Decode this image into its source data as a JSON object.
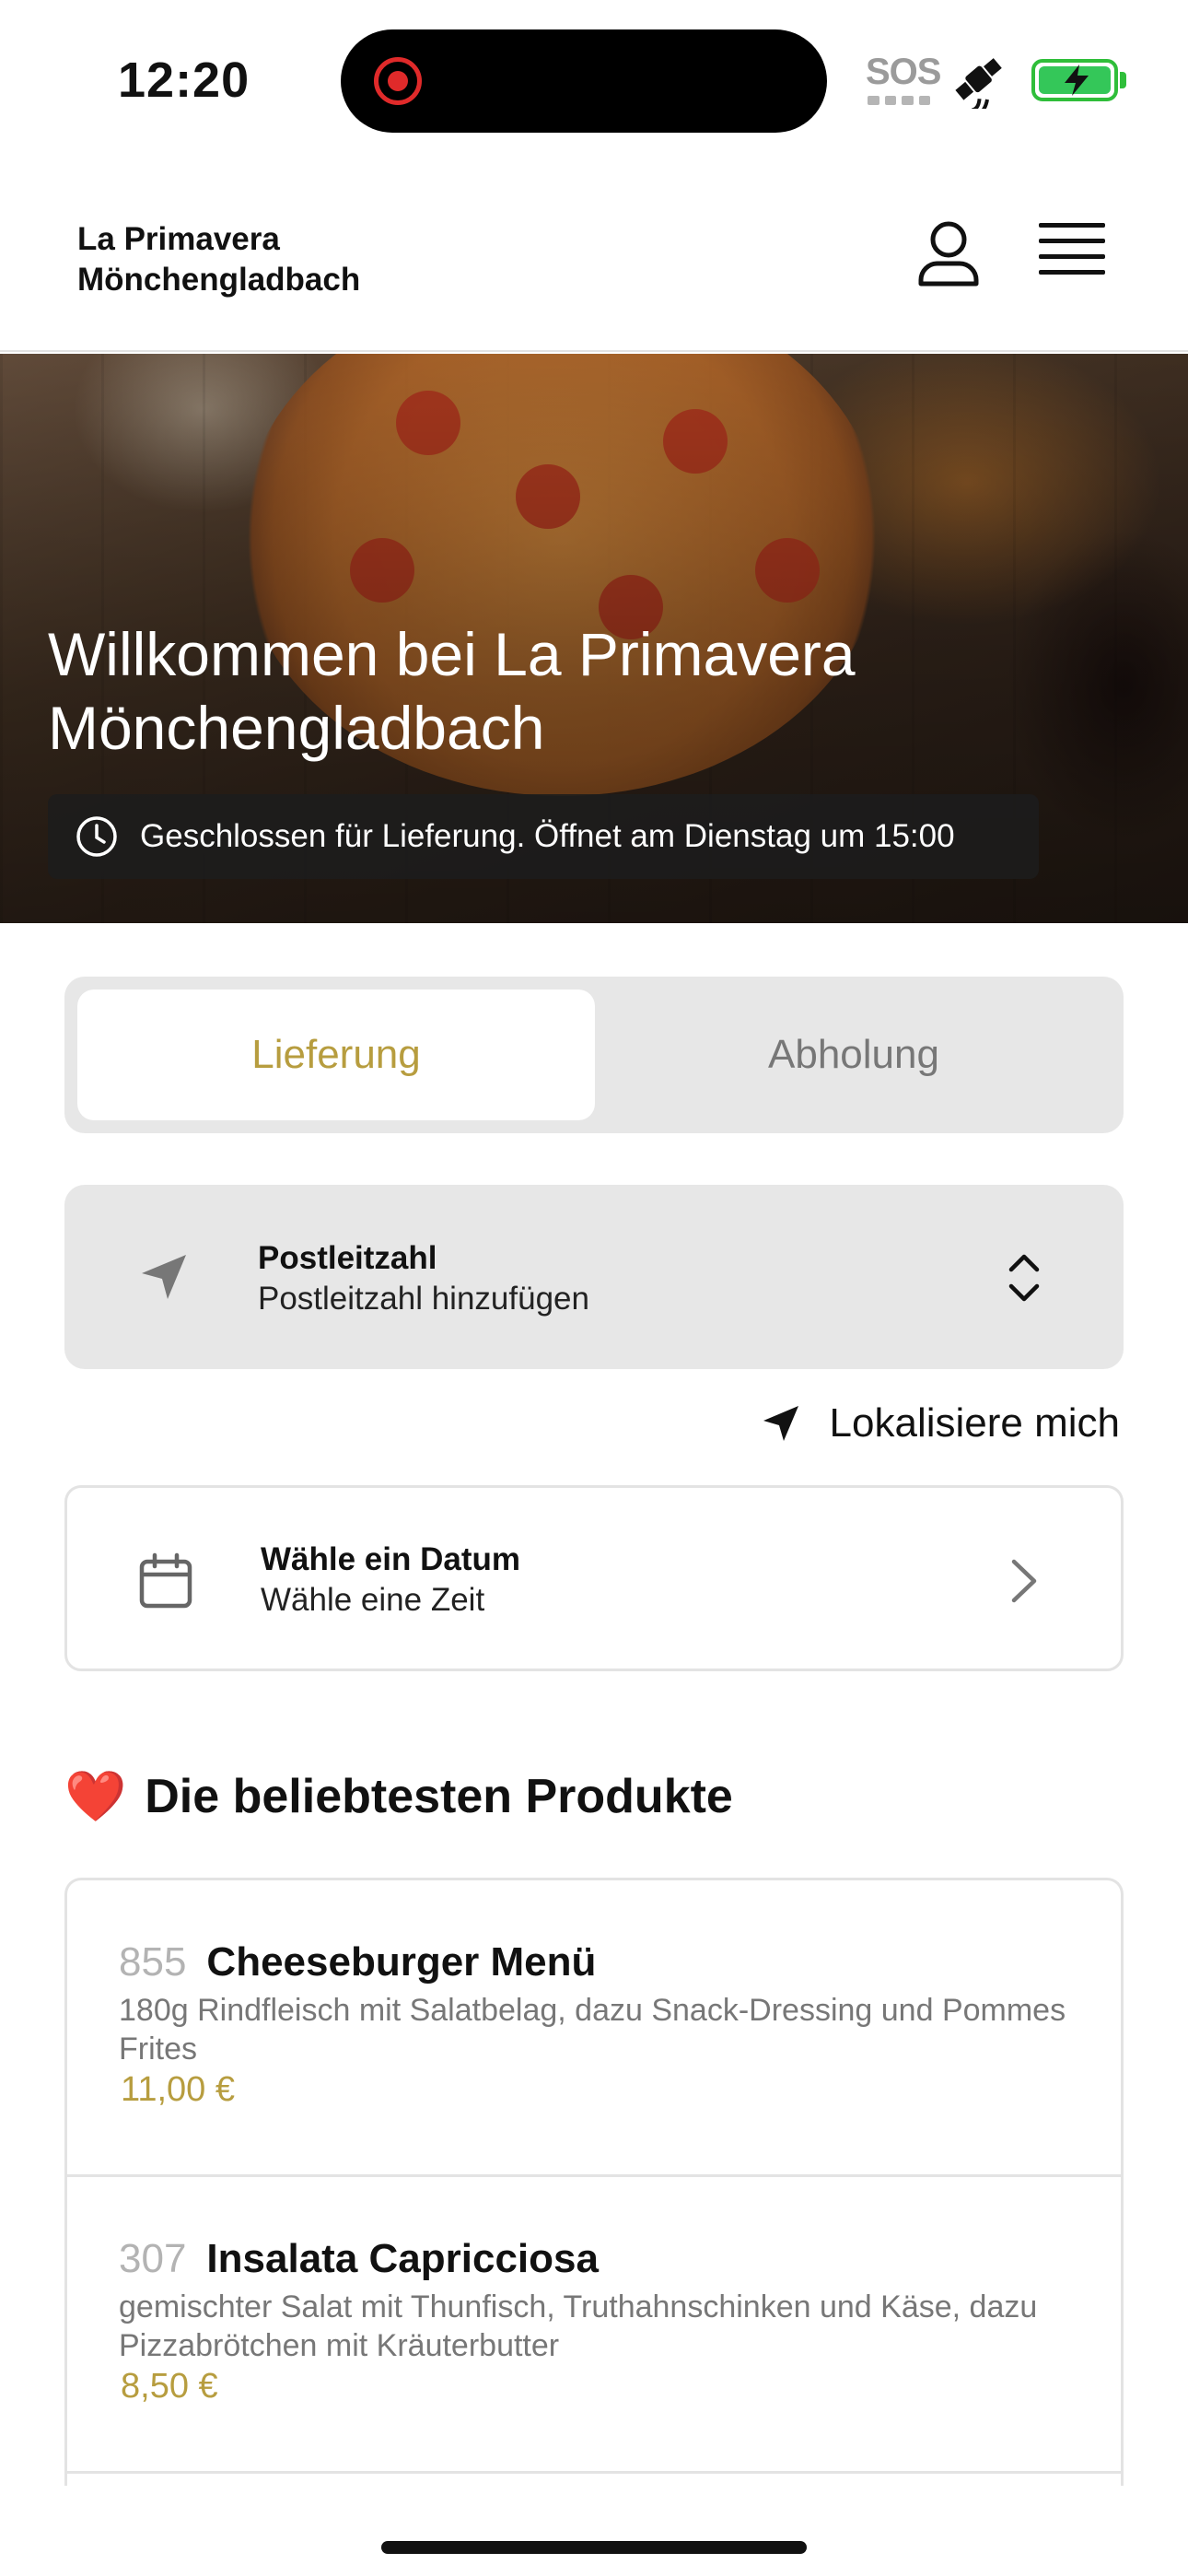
{
  "status_bar": {
    "time": "12:20",
    "sos": "SOS",
    "icons": [
      "screen-recording-icon",
      "satellite-icon",
      "battery-charging-icon"
    ]
  },
  "header": {
    "brand_line1": "La Primavera",
    "brand_line2": "Mönchengladbach",
    "icons": [
      "user-icon",
      "hamburger-menu-icon"
    ]
  },
  "hero": {
    "title_line1": "Willkommen bei La Primavera",
    "title_line2": "Mönchengladbach",
    "status": "Geschlossen für Lieferung. Öffnet am Dienstag um 15:00"
  },
  "tabs": [
    {
      "label": "Lieferung",
      "active": true
    },
    {
      "label": "Abholung",
      "active": false
    }
  ],
  "postal": {
    "label": "Postleitzahl",
    "sub": "Postleitzahl hinzufügen"
  },
  "locate": {
    "label": "Lokalisiere mich"
  },
  "date": {
    "label": "Wähle ein Datum",
    "sub": "Wähle eine Zeit"
  },
  "popular": {
    "emoji": "❤️",
    "title": "Die beliebtesten Produkte"
  },
  "products": [
    {
      "number": "855",
      "name": "Cheeseburger Menü",
      "description": "180g Rindfleisch mit Salatbelag, dazu Snack-Dressing und Pommes Frites",
      "price": "11,00 €"
    },
    {
      "number": "307",
      "name": "Insalata Capricciosa",
      "description": "gemischter Salat mit Thunfisch, Truthahnschinken und Käse, dazu Pizzabrötchen mit Kräuterbutter",
      "price": "8,50 €"
    }
  ],
  "colors": {
    "accent_gold": "#b79d3f",
    "panel_gray": "#e7e7e7",
    "battery_green": "#34c759",
    "record_red": "#e02a2a"
  }
}
